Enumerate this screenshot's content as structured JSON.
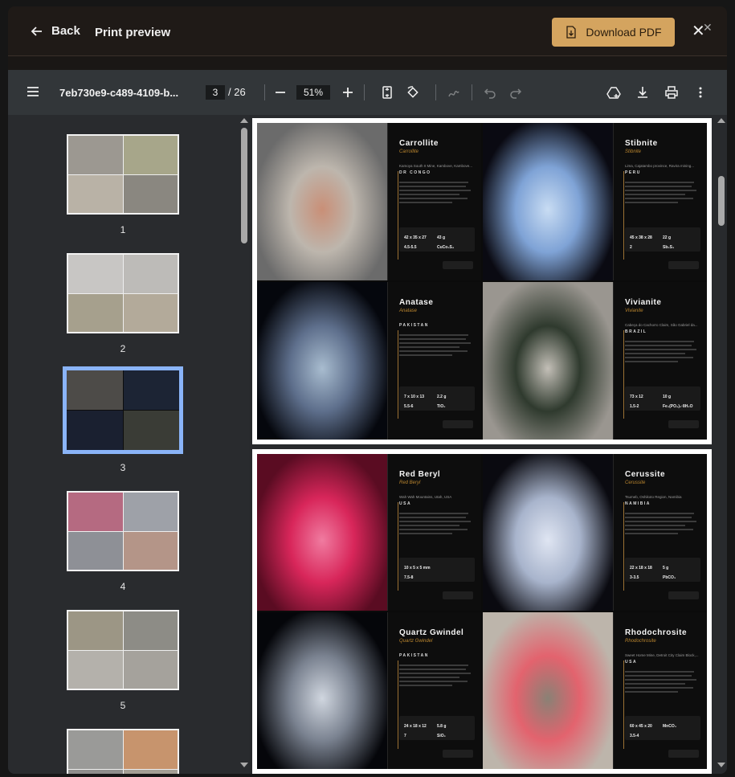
{
  "header": {
    "back_label": "Back",
    "title": "Print preview",
    "download_label": "Download PDF"
  },
  "toolbar": {
    "file_name": "7eb730e9-c489-4109-b...",
    "current_page": "3",
    "total_pages": "/ 26",
    "zoom": "51%"
  },
  "thumbnails": [
    {
      "number": "1"
    },
    {
      "number": "2"
    },
    {
      "number": "3",
      "selected": true
    },
    {
      "number": "4"
    },
    {
      "number": "5"
    }
  ],
  "pages": [
    {
      "cards": [
        {
          "name": "Carrollite",
          "subtitle": "Carrollite",
          "location": "Kamoya South II Mine, Kambove, Kambove...",
          "country": "DR CONGO",
          "dims": "42 x 35 x 27",
          "weight": "43 g",
          "hardness": "4.5-5.5",
          "formula": "CuCo₂S₄",
          "photo_colors": [
            "#6b6b6b",
            "#bdb6ad",
            "#c98f77"
          ]
        },
        {
          "name": "Stibnite",
          "subtitle": "Stibnite",
          "location": "Lima, Cajatambo province, Ravira mining...",
          "country": "PERU",
          "dims": "45 x 38 x 28",
          "weight": "22 g",
          "hardness": "2",
          "formula": "Sb₂S₃",
          "photo_colors": [
            "#0a0a12",
            "#7fa3d6",
            "#c8dcf3"
          ]
        },
        {
          "name": "Anatase",
          "subtitle": "Anatase",
          "location": "",
          "country": "PAKISTAN",
          "dims": "7 x 10 x 13",
          "weight": "2.2 g",
          "hardness": "5.5-6",
          "formula": "TiO₂",
          "photo_colors": [
            "#05070d",
            "#5e6f8c",
            "#a8bccf"
          ]
        },
        {
          "name": "Vivianite",
          "subtitle": "Vivianite",
          "location": "Cabeça do Cachorro Claim, São Gabriel da...",
          "country": "BRAZIL",
          "dims": "73 x 12",
          "weight": "10 g",
          "hardness": "1.5-2",
          "formula": "Fe₃(PO₄)₂·8H₂O",
          "photo_colors": [
            "#9a9690",
            "#2f3a2e",
            "#c3bfb7"
          ]
        }
      ]
    },
    {
      "cards": [
        {
          "name": "Red Beryl",
          "subtitle": "Red Beryl",
          "location": "Wah Wah Mountains, Utah, USA",
          "country": "USA",
          "dims": "10 x 5 x 5 mm",
          "weight": "",
          "hardness": "7.5-8",
          "formula": "",
          "photo_colors": [
            "#5a0c22",
            "#d8265a",
            "#f07ba0"
          ]
        },
        {
          "name": "Cerussite",
          "subtitle": "Cerussite",
          "location": "Tsumeb, Oshikoto Region, Namibia",
          "country": "NAMIBIA",
          "dims": "22 x 18 x 18",
          "weight": "5 g",
          "hardness": "3-3.5",
          "formula": "PbCO₃",
          "photo_colors": [
            "#0a0a10",
            "#a8b4cc",
            "#dfe5f2"
          ]
        },
        {
          "name": "Quartz Gwindel",
          "subtitle": "Quartz Gwindel",
          "location": "",
          "country": "PAKISTAN",
          "dims": "24 x 18 x 12",
          "weight": "5.8 g",
          "hardness": "7",
          "formula": "SiO₂",
          "photo_colors": [
            "#05060a",
            "#7a8290",
            "#d0d6df"
          ]
        },
        {
          "name": "Rhodochrosite",
          "subtitle": "Rhodochrosite",
          "location": "Sweet Home Mine, Detroit City Claim Block,...",
          "country": "USA",
          "dims": "60 x 45 x 20",
          "weight": "",
          "hardness": "3.5-4",
          "formula": "MnCO₃",
          "photo_colors": [
            "#bdb5ab",
            "#e3636e",
            "#8a8175"
          ]
        }
      ]
    }
  ]
}
